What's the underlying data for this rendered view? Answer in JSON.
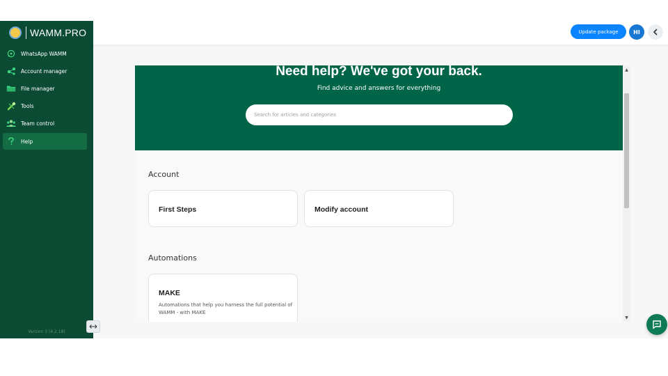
{
  "brand": {
    "name": "WAMM.PRO"
  },
  "topbar": {
    "update_label": "Update package",
    "avatar_initials": "HI"
  },
  "sidebar": {
    "items": [
      {
        "label": "WhatsApp WAMM",
        "icon": "whatsapp-icon"
      },
      {
        "label": "Account manager",
        "icon": "share-nodes-icon"
      },
      {
        "label": "File manager",
        "icon": "folder-icon"
      },
      {
        "label": "Tools",
        "icon": "tools-icon"
      },
      {
        "label": "Team control",
        "icon": "team-icon"
      },
      {
        "label": "Help",
        "icon": "question-icon"
      }
    ],
    "active_item": "Help",
    "version": "Version 3 (4.2.18)"
  },
  "help": {
    "title": "Need help? We've got your back.",
    "subtitle": "Find advice and answers for everything",
    "search_placeholder": "Search for articles and categories",
    "sections": [
      {
        "title": "Account",
        "cards": [
          {
            "title": "First Steps"
          },
          {
            "title": "Modify account"
          }
        ]
      },
      {
        "title": "Automations",
        "cards": [
          {
            "title": "MAKE",
            "description": "Automations that help you harness the full potential of WAMM - with MAKE"
          }
        ]
      }
    ]
  },
  "colors": {
    "sidebar_bg": "#0b4b33",
    "sidebar_active": "#146c45",
    "hero_bg": "#006548",
    "update_button": "#0a84ff",
    "avatar": "#1976d2",
    "chat_button": "#0f7a58"
  },
  "icons": {
    "sidebar_toggle": "expand-arrows-icon",
    "chat": "chat-icon",
    "collapse": "chevron-left-icon"
  }
}
